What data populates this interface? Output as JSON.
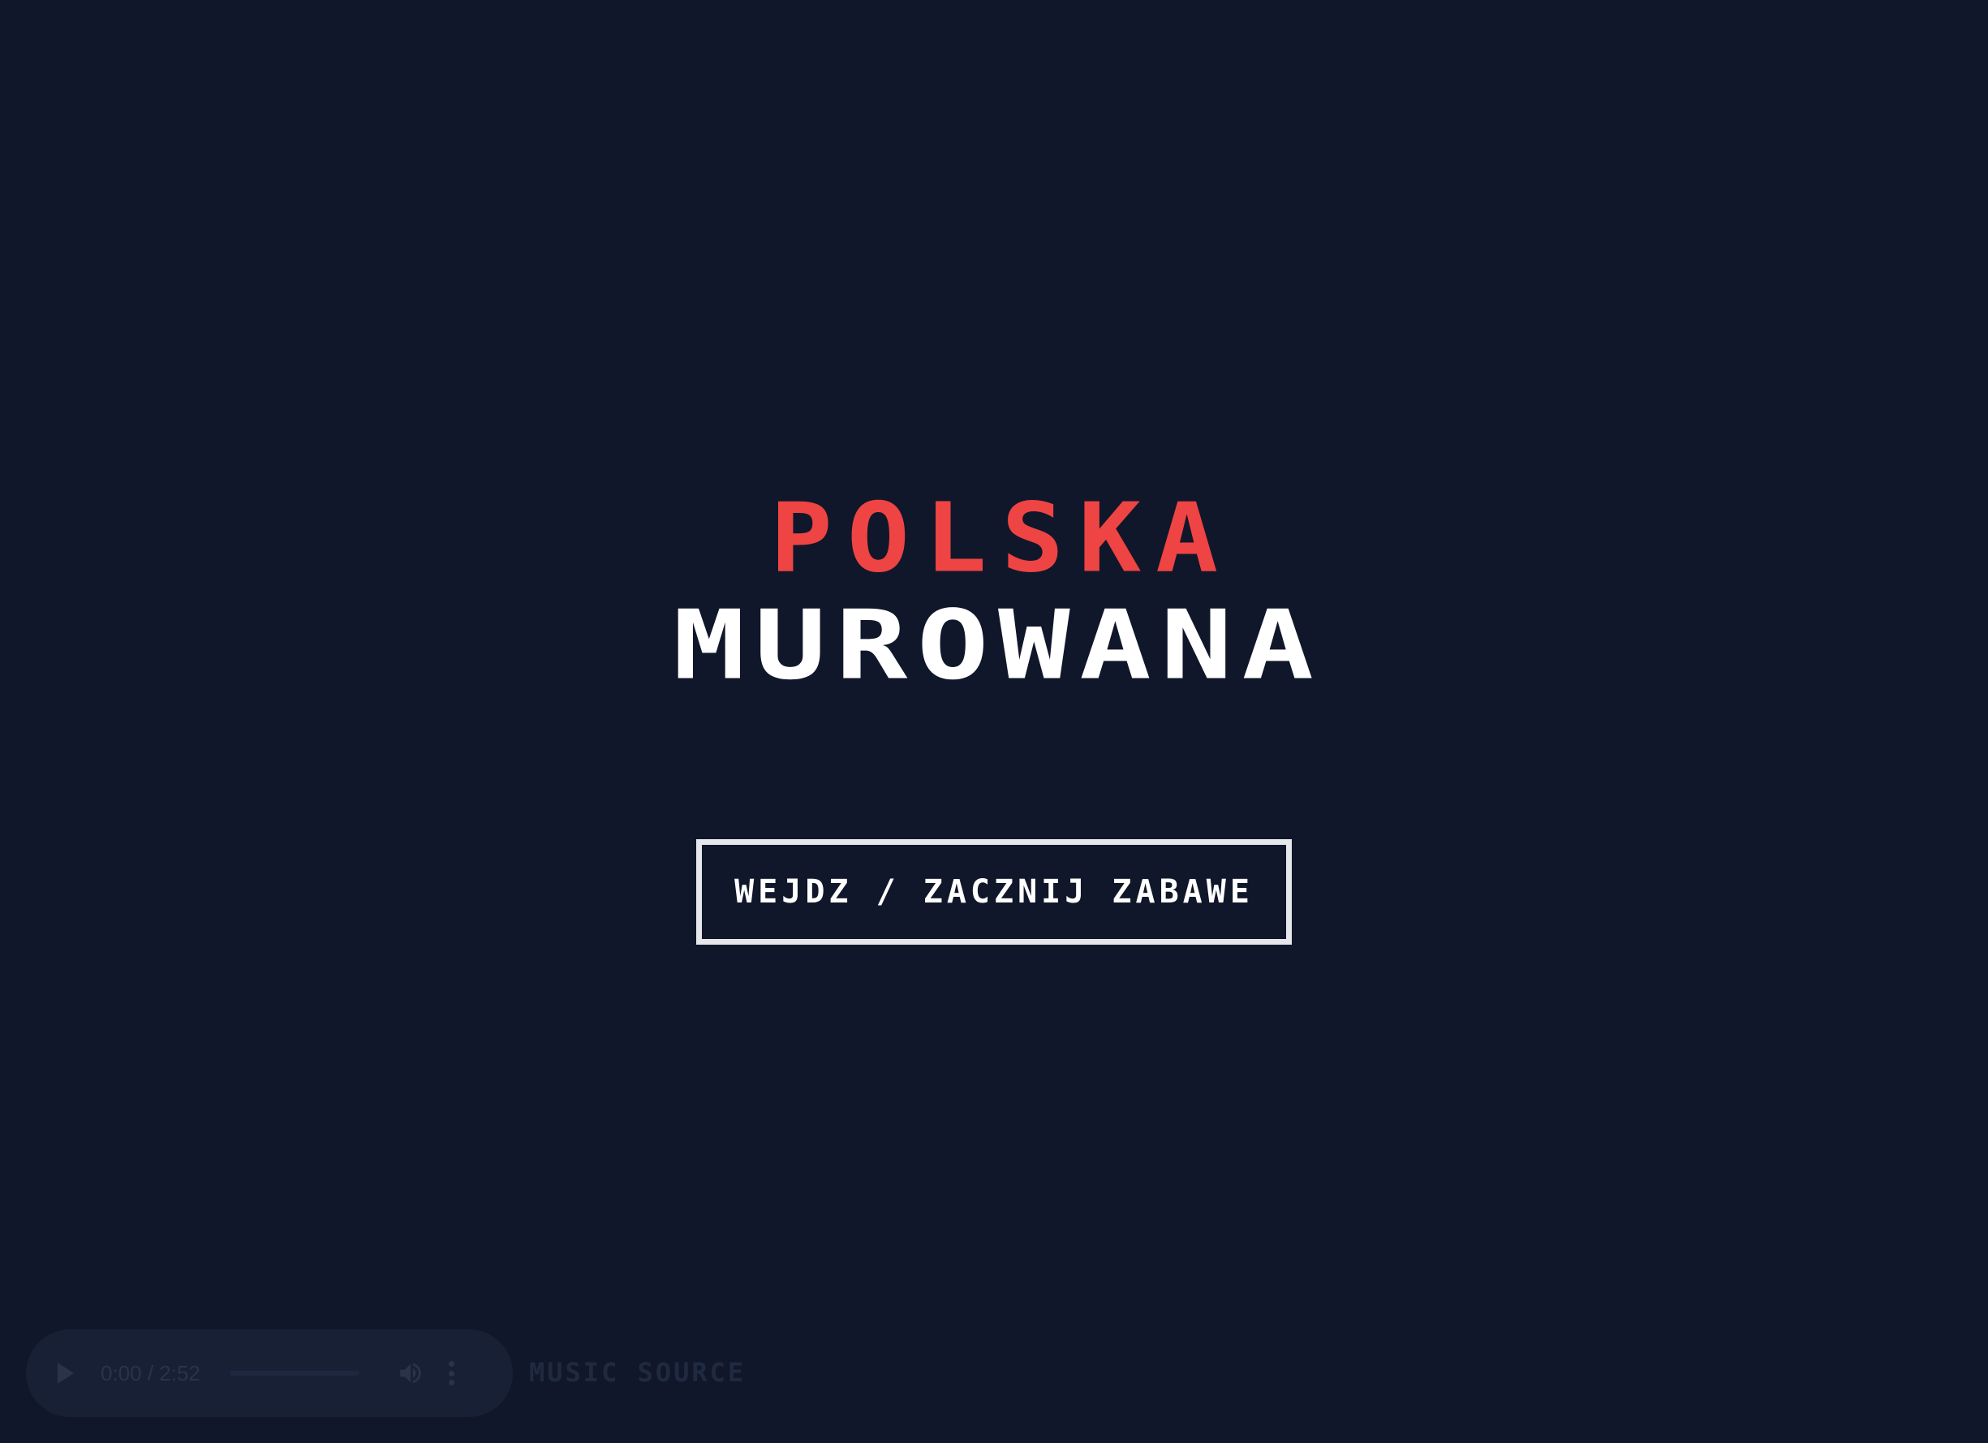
{
  "title": {
    "line1": "POLSKA",
    "line2": "MUROWANA"
  },
  "enter_button": {
    "label": "WEJDZ / ZACZNIJ ZABAWE"
  },
  "audio_player": {
    "time": "0:00 / 2:52",
    "progress": 0
  },
  "music_source": {
    "label": "MUSIC SOURCE"
  },
  "colors": {
    "background": "#11172a",
    "accent_red": "#ef4444",
    "text_white": "#ffffff",
    "button_border": "#e5e7eb"
  },
  "icons": {
    "play": "play-icon",
    "volume": "volume-icon",
    "menu": "more-vertical-icon"
  }
}
